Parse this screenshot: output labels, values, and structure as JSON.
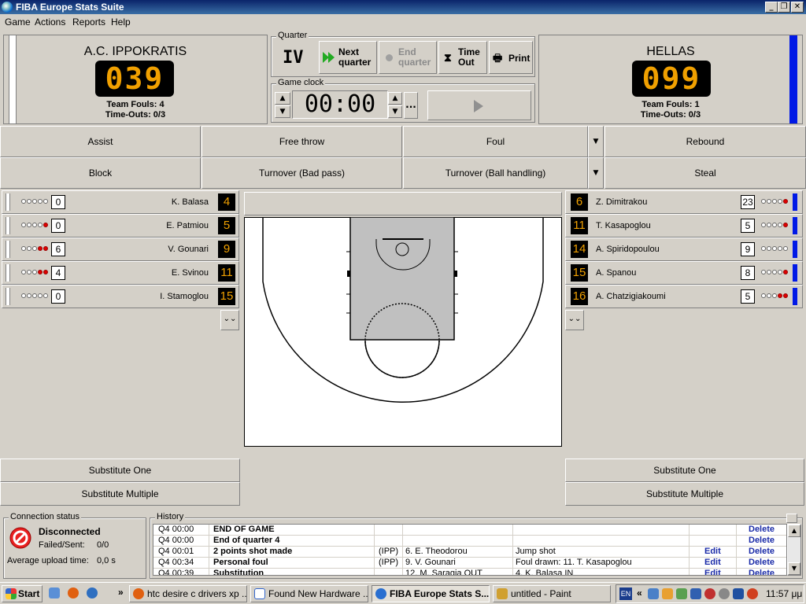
{
  "window": {
    "title": "FIBA Europe Stats Suite"
  },
  "menu": [
    "Game",
    "Actions",
    "Reports",
    "Help"
  ],
  "home": {
    "name": "A.C. IPPOKRATIS",
    "score": "039",
    "team_fouls": "Team Fouls: 4",
    "timeouts": "Time-Outs: 0/3"
  },
  "away": {
    "name": "HELLAS",
    "score": "099",
    "team_fouls": "Team Fouls: 1",
    "timeouts": "Time-Outs: 0/3"
  },
  "quarter": {
    "label": "Quarter",
    "value": "IV",
    "next1": "Next",
    "next2": "quarter",
    "end1": "End",
    "end2": "quarter",
    "to1": "Time",
    "to2": "Out",
    "print": "Print"
  },
  "clock": {
    "label": "Game clock",
    "value": "00:00",
    "more": "..."
  },
  "actions": {
    "row1": [
      "Assist",
      "Free throw",
      "Foul",
      "Rebound"
    ],
    "row2": [
      "Block",
      "Turnover (Bad pass)",
      "Turnover (Ball handling)",
      "Steal"
    ]
  },
  "home_players": [
    {
      "name": "K. Balasa",
      "number": "4",
      "points": "0",
      "fouls": 0
    },
    {
      "name": "E. Patmiou",
      "number": "5",
      "points": "0",
      "fouls": 1
    },
    {
      "name": "V. Gounari",
      "number": "9",
      "points": "6",
      "fouls": 2
    },
    {
      "name": "E. Svinou",
      "number": "11",
      "points": "4",
      "fouls": 2
    },
    {
      "name": "I. Stamoglou",
      "number": "15",
      "points": "0",
      "fouls": 0
    }
  ],
  "away_players": [
    {
      "name": "Z. Dimitrakou",
      "number": "6",
      "points": "23",
      "fouls": 1
    },
    {
      "name": "T. Kasapoglou",
      "number": "11",
      "points": "5",
      "fouls": 1
    },
    {
      "name": "A. Spiridopoulou",
      "number": "14",
      "points": "9",
      "fouls": 0
    },
    {
      "name": "A. Spanou",
      "number": "15",
      "points": "8",
      "fouls": 1
    },
    {
      "name": "A. Chatzigiakoumi",
      "number": "16",
      "points": "5",
      "fouls": 2
    }
  ],
  "subs": {
    "one": "Substitute One",
    "multiple": "Substitute Multiple"
  },
  "connection": {
    "label": "Connection status",
    "status": "Disconnected",
    "failed_label": "Failed/Sent:",
    "failed_value": "0/0",
    "upload_label": "Average upload time:",
    "upload_value": "0,0 s"
  },
  "history": {
    "label": "History",
    "rows": [
      {
        "time": "Q4 00:00",
        "event": "END OF GAME",
        "team": "",
        "player": "",
        "detail": "",
        "edit": "",
        "delete": "Delete"
      },
      {
        "time": "Q4 00:00",
        "event": "End of quarter 4",
        "team": "",
        "player": "",
        "detail": "",
        "edit": "",
        "delete": "Delete"
      },
      {
        "time": "Q4 00:01",
        "event": "2 points shot made",
        "team": "(IPP)",
        "player": "6. E. Theodorou",
        "detail": "Jump shot",
        "edit": "Edit",
        "delete": "Delete"
      },
      {
        "time": "Q4 00:34",
        "event": "Personal  foul",
        "team": "(IPP)",
        "player": "9. V. Gounari",
        "detail": "Foul drawn: 11. T. Kasapoglou",
        "edit": "Edit",
        "delete": "Delete"
      },
      {
        "time": "Q4 00:39",
        "event": "Substitution",
        "team": "",
        "player": "12. M. Saragia OUT",
        "detail": "4. K. Balasa IN",
        "edit": "Edit",
        "delete": "Delete"
      }
    ]
  },
  "taskbar": {
    "start": "Start",
    "items": [
      "htc desire c drivers xp ...",
      "Found New Hardware ...",
      "FIBA Europe Stats S...",
      "untitled - Paint"
    ],
    "lang": "EN",
    "clock": "11:57 μμ"
  }
}
